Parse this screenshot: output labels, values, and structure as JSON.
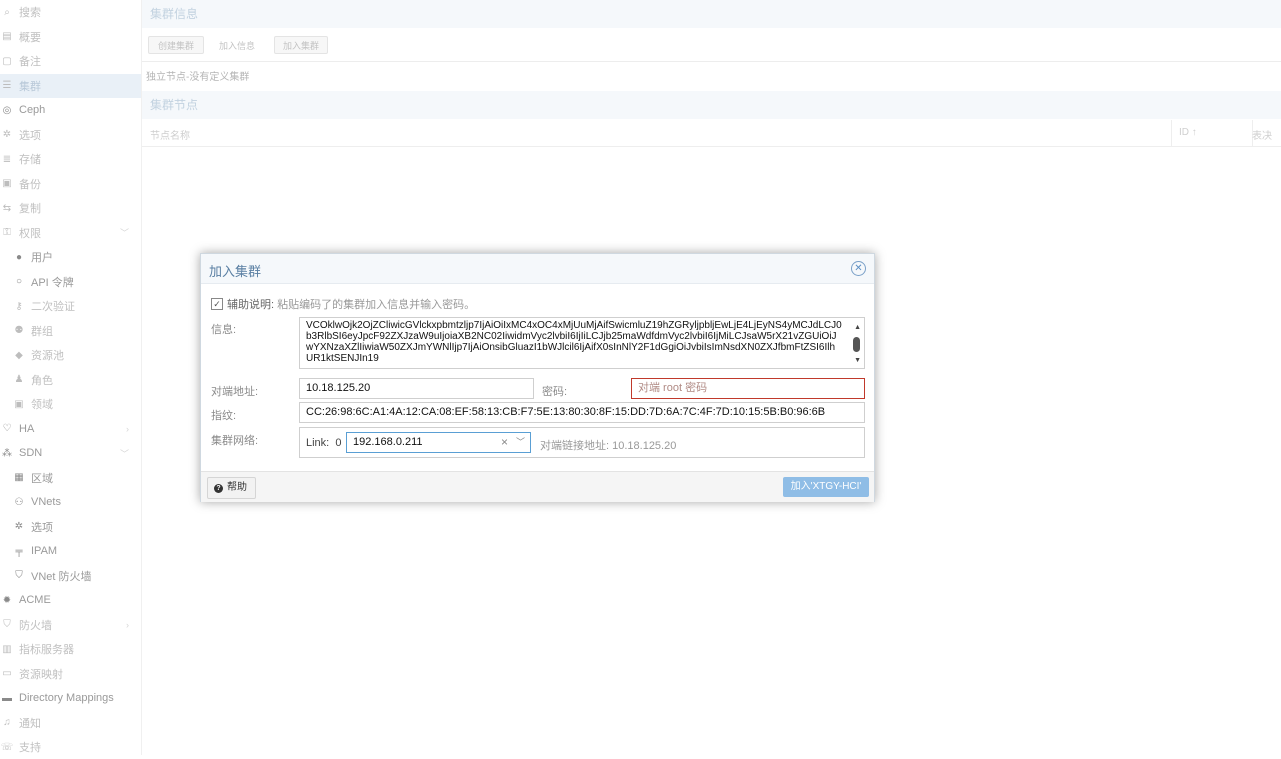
{
  "sidebar": {
    "items": [
      {
        "label": "搜索",
        "icon": "search-icon",
        "glyph": "⌕"
      },
      {
        "label": "概要",
        "icon": "book-icon",
        "glyph": "▤"
      },
      {
        "label": "备注",
        "icon": "note-icon",
        "glyph": "▢"
      },
      {
        "label": "集群",
        "icon": "server-icon",
        "glyph": "☰"
      },
      {
        "label": "Ceph",
        "icon": "ceph-icon",
        "glyph": "◎"
      },
      {
        "label": "选项",
        "icon": "gear-icon",
        "glyph": "✲"
      },
      {
        "label": "存储",
        "icon": "database-icon",
        "glyph": "≣"
      },
      {
        "label": "备份",
        "icon": "floppy-icon",
        "glyph": "▣"
      },
      {
        "label": "复制",
        "icon": "retweet-icon",
        "glyph": "⇆"
      },
      {
        "label": "权限",
        "icon": "unlock-icon",
        "glyph": "⚿"
      },
      {
        "label": "用户",
        "icon": "user-icon",
        "glyph": "●"
      },
      {
        "label": "API 令牌",
        "icon": "user-outline-icon",
        "glyph": "○"
      },
      {
        "label": "二次验证",
        "icon": "key-icon",
        "glyph": "⚷"
      },
      {
        "label": "群组",
        "icon": "users-icon",
        "glyph": "⚉"
      },
      {
        "label": "资源池",
        "icon": "tags-icon",
        "glyph": "◆"
      },
      {
        "label": "角色",
        "icon": "male-icon",
        "glyph": "♟"
      },
      {
        "label": "领域",
        "icon": "address-book-icon",
        "glyph": "▣"
      },
      {
        "label": "HA",
        "icon": "heartbeat-icon",
        "glyph": "♡"
      },
      {
        "label": "SDN",
        "icon": "sdn-icon",
        "glyph": "⁂"
      },
      {
        "label": "区域",
        "icon": "th-icon",
        "glyph": "▦"
      },
      {
        "label": "VNets",
        "icon": "sitemap-icon",
        "glyph": "⚇"
      },
      {
        "label": "选项",
        "icon": "gear-icon",
        "glyph": "✲"
      },
      {
        "label": "IPAM",
        "icon": "ipam-icon",
        "glyph": "╤"
      },
      {
        "label": "VNet 防火墙",
        "icon": "shield-icon",
        "glyph": "⛉"
      },
      {
        "label": "ACME",
        "icon": "certificate-icon",
        "glyph": "✹"
      },
      {
        "label": "防火墙",
        "icon": "shield-icon",
        "glyph": "⛉"
      },
      {
        "label": "指标服务器",
        "icon": "bar-chart-icon",
        "glyph": "▥"
      },
      {
        "label": "资源映射",
        "icon": "folder-icon",
        "glyph": "▭"
      },
      {
        "label": "Directory Mappings",
        "icon": "folder-icon",
        "glyph": "▬"
      },
      {
        "label": "通知",
        "icon": "bell-icon",
        "glyph": "♫"
      },
      {
        "label": "支持",
        "icon": "comments-icon",
        "glyph": "☏"
      }
    ]
  },
  "main": {
    "cluster_info_title": "集群信息",
    "toolbar": {
      "create_cluster": "创建集群",
      "join_info": "加入信息",
      "join_cluster": "加入集群"
    },
    "standalone_note": "独立节点-没有定义集群",
    "nodes_title": "集群节点",
    "grid_columns": {
      "name": "节点名称",
      "id": "ID ↑",
      "votes": "表决"
    }
  },
  "dialog": {
    "title": "加入集群",
    "assist_label": "辅助说明:",
    "assist_hint": "粘贴编码了的集群加入信息并输入密码。",
    "info_label": "信息:",
    "info_value": "VCOklwOjk2OjZCliwicGVlckxpbmtzljp7IjAiOiIxMC4xOC4xMjUuMjAifSwicmluZ19hZGRyljpbljEwLjE4LjEyNS4yMCJdLCJ0b3RlbSI6eyJpcF92ZXJzaW9uIjoiaXB2NC02IiwidmVyc2lvbiI6IjIiLCJjb25maWdfdmVyc2lvbiI6IjMiLCJsaW5rX21vZGUiOiJwYXNzaXZlIiwiaW50ZXJmYWNlIjp7IjAiOnsibGluazI1bWJlcil6IjAifX0sInNlY2F1dGgiOiJvbiIsImNsdXN0ZXJfbmFtZSI6IlhUR1ktSENJIn19",
    "peer_address_label": "对端地址:",
    "peer_address_value": "10.18.125.20",
    "password_label": "密码:",
    "password_placeholder": "对端 root 密码",
    "fingerprint_label": "指纹:",
    "fingerprint_value": "CC:26:98:6C:A1:4A:12:CA:08:EF:58:13:CB:F7:5E:13:80:30:8F:15:DD:7D:6A:7C:4F:7D:10:15:5B:B0:96:6B",
    "cluster_network_label": "集群网络:",
    "link_label": "Link:",
    "link_number": "0",
    "link_address": "192.168.0.211",
    "peer_link_address": "对端链接地址: 10.18.125.20",
    "help_label": "帮助",
    "join_button_label": "加入'XTGY-HCI'"
  }
}
